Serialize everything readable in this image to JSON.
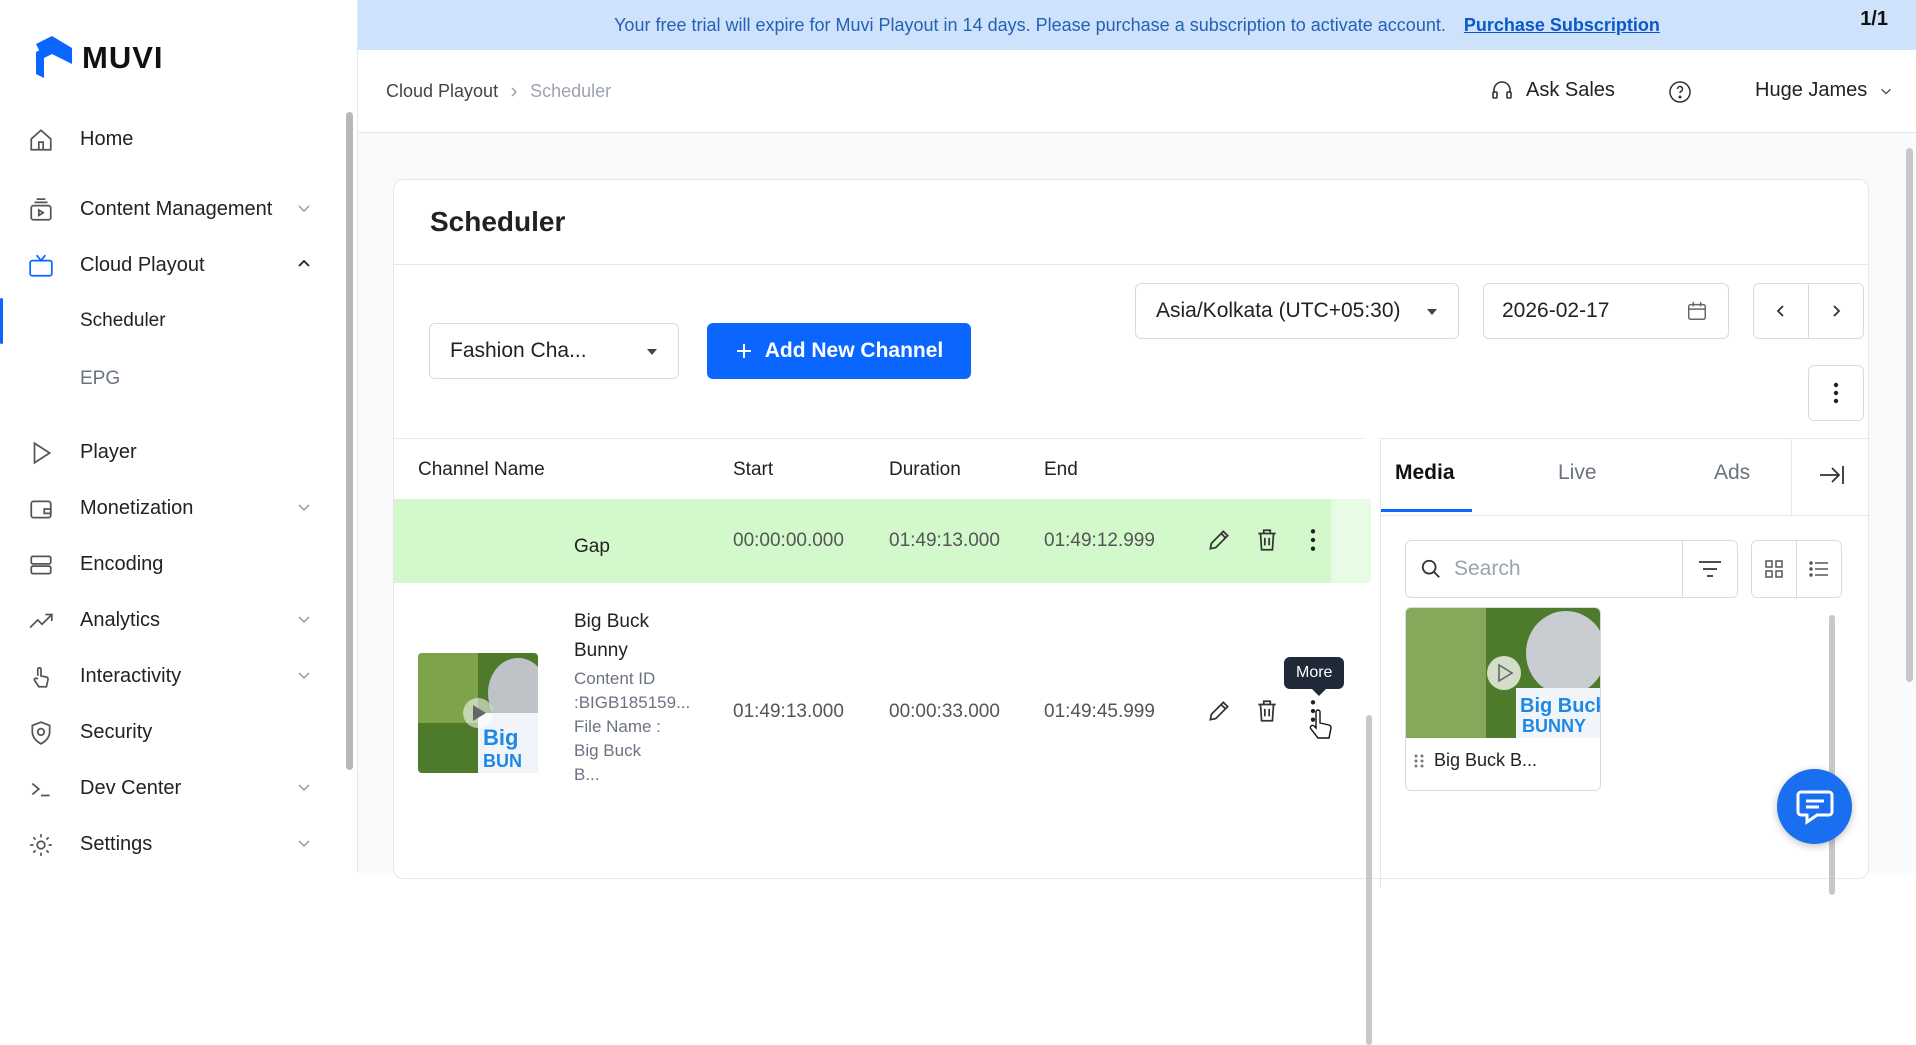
{
  "brand": {
    "name": "MUVI"
  },
  "banner": {
    "message": "Your free trial will expire for Muvi Playout in 14 days. Please purchase a subscription to activate account.",
    "link": "Purchase Subscription",
    "counter": "1/1"
  },
  "sidebar": {
    "items": [
      {
        "label": "Home"
      },
      {
        "label": "Content Management"
      },
      {
        "label": "Cloud Playout"
      },
      {
        "label": "Player"
      },
      {
        "label": "Monetization"
      },
      {
        "label": "Encoding"
      },
      {
        "label": "Analytics"
      },
      {
        "label": "Interactivity"
      },
      {
        "label": "Security"
      },
      {
        "label": "Dev Center"
      },
      {
        "label": "Settings"
      }
    ],
    "sub_items": [
      {
        "label": "Scheduler"
      },
      {
        "label": "EPG"
      }
    ]
  },
  "topbar": {
    "breadcrumb": [
      "Cloud Playout",
      "Scheduler"
    ],
    "ask_sales": "Ask Sales",
    "user_name": "Huge James"
  },
  "page": {
    "title": "Scheduler",
    "channel_select": "Fashion Cha...",
    "add_channel": "Add New Channel",
    "timezone": "Asia/Kolkata (UTC+05:30)",
    "date": "2026-02-17"
  },
  "table": {
    "headers": [
      "Channel Name",
      "Start",
      "Duration",
      "End"
    ],
    "rows": [
      {
        "name": "Gap",
        "start": "00:00:00.000",
        "duration": "01:49:13.000",
        "end": "01:49:12.999"
      },
      {
        "name_line1": "Big Buck",
        "name_line2": "Bunny",
        "meta1": "Content ID",
        "meta2": ":BIGB185159...",
        "meta3": "File Name :",
        "meta4": "Big Buck",
        "meta5": "B...",
        "start": "01:49:13.000",
        "duration": "00:00:33.000",
        "end": "01:49:45.999"
      }
    ],
    "tooltip": "More"
  },
  "panel": {
    "tabs": [
      "Media",
      "Live",
      "Ads"
    ],
    "search_placeholder": "Search",
    "media_items": [
      {
        "name": "Big Buck B..."
      }
    ]
  },
  "colors": {
    "accent": "#0a66ff",
    "gap_row": "#d3f8cc",
    "banner": "#cfe2fb"
  }
}
